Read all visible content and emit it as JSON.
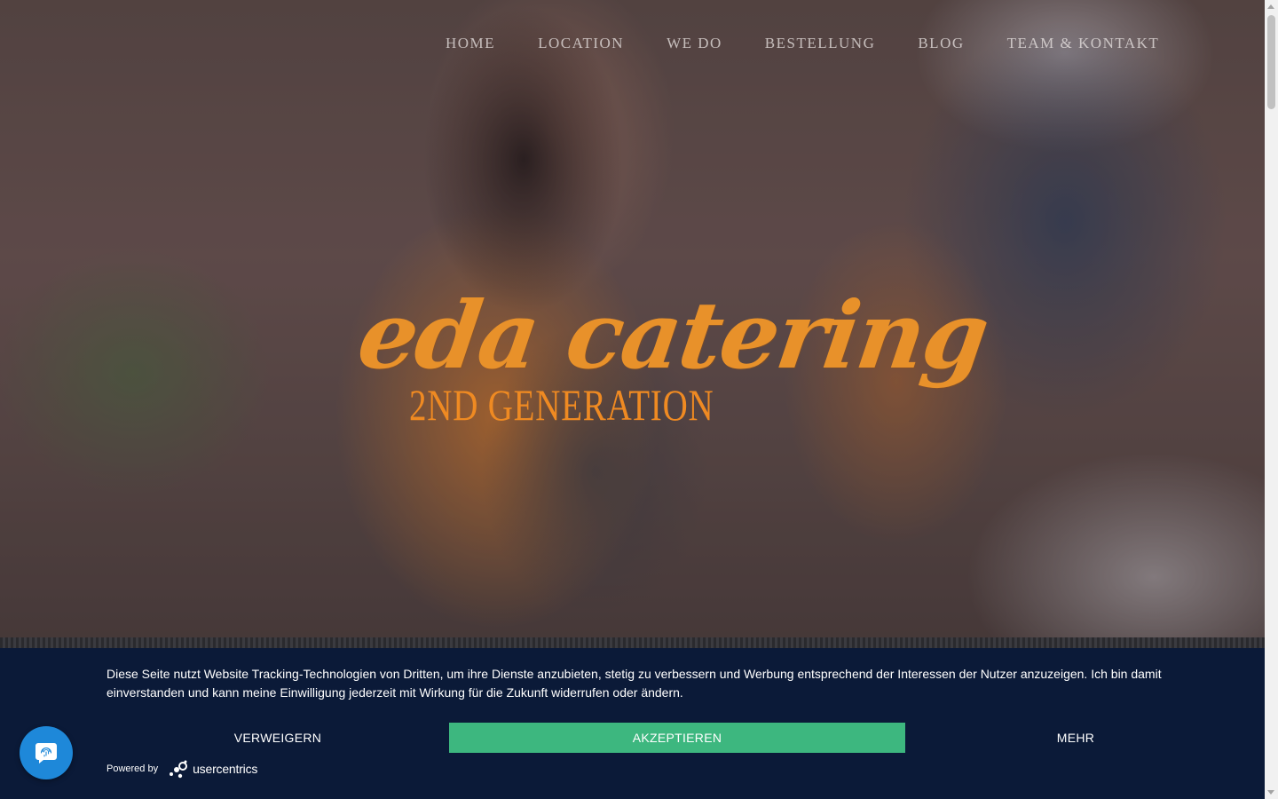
{
  "nav": {
    "items": [
      {
        "label": "HOME"
      },
      {
        "label": "LOCATION"
      },
      {
        "label": "WE DO"
      },
      {
        "label": "BESTELLUNG"
      },
      {
        "label": "BLOG"
      },
      {
        "label": "TEAM & KONTAKT"
      }
    ]
  },
  "hero": {
    "logo_title": "eda catering",
    "logo_subtitle": "2ND GENERATION",
    "logo_color": "#e8912a"
  },
  "consent": {
    "text": "Diese Seite nutzt Website Tracking-Technologien von Dritten, um ihre Dienste anzubieten, stetig zu verbessern und Werbung entsprechend der Interessen der Nutzer anzuzeigen. Ich bin damit einverstanden und kann meine Einwilligung jederzeit mit Wirkung für die Zukunft widerrufen oder ändern.",
    "deny_label": "VERWEIGERN",
    "accept_label": "AKZEPTIEREN",
    "more_label": "MEHR",
    "powered_by_label": "Powered by",
    "provider_name": "usercentrics",
    "background_color": "#0b1a38",
    "accept_color": "#3db77f"
  },
  "privacy_button": {
    "icon": "fingerprint-icon",
    "color": "#1e88d9"
  }
}
